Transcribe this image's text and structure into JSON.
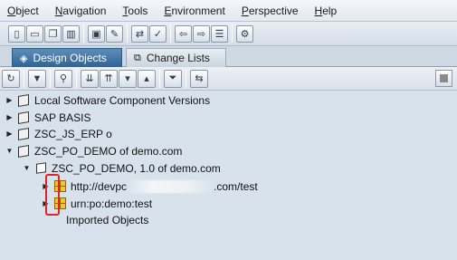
{
  "menu": [
    {
      "label": "Object",
      "u": "O",
      "rest": "bject"
    },
    {
      "label": "Navigation",
      "u": "N",
      "rest": "avigation"
    },
    {
      "label": "Tools",
      "u": "T",
      "rest": "ools"
    },
    {
      "label": "Environment",
      "u": "E",
      "rest": "nvironment"
    },
    {
      "label": "Perspective",
      "u": "P",
      "rest": "erspective"
    },
    {
      "label": "Help",
      "u": "H",
      "rest": "elp"
    }
  ],
  "tabs": {
    "design_objects": "Design Objects",
    "change_lists": "Change Lists"
  },
  "tree": {
    "local_swc": "Local Software Component Versions",
    "sap_basis": "SAP BASIS",
    "zsc_js_erp": "ZSC_JS_ERP o",
    "zsc_po_demo": "ZSC_PO_DEMO of demo.com",
    "zsc_po_demo_version": "ZSC_PO_DEMO, 1.0 of demo.com",
    "ns1_prefix": "http://devpc",
    "ns1_suffix": ".com/test",
    "ns2": "urn:po:demo:test",
    "imported": "Imported Objects"
  },
  "colors": {
    "highlight": "#e1232a",
    "active_tab": "#2f6497"
  }
}
